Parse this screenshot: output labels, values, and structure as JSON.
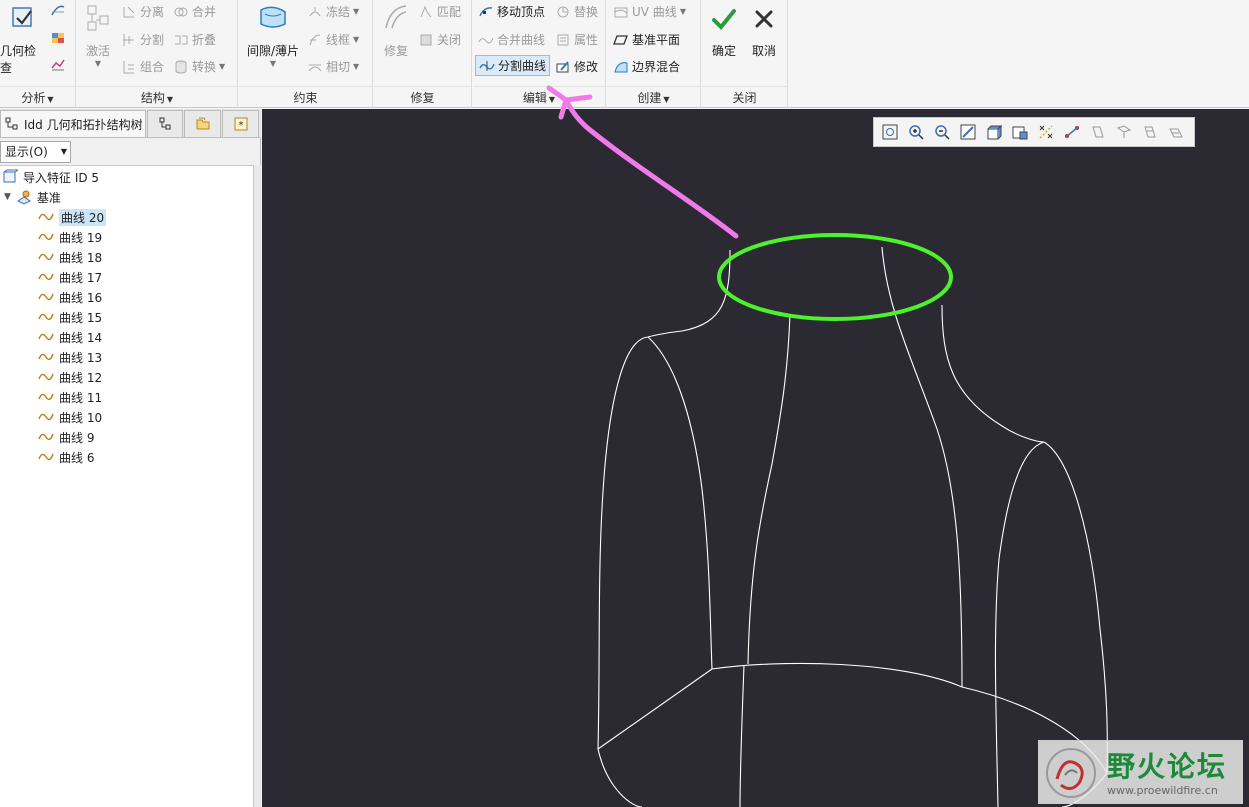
{
  "ribbon": {
    "analysis": {
      "geometry_check": "几何检查",
      "group_label": "分析"
    },
    "structure": {
      "activate": "激活",
      "separate": "分离",
      "merge": "合并",
      "split": "分割",
      "fold": "折叠",
      "combine": "组合",
      "convert": "转换",
      "group_label": "结构"
    },
    "constraint": {
      "gap_thin": "间隙/薄片",
      "freeze": "冻结",
      "wireframe": "线框",
      "tangent": "相切",
      "group_label": "约束"
    },
    "repair": {
      "repair": "修复",
      "match": "匹配",
      "close": "关闭",
      "group_label": "修复"
    },
    "edit": {
      "move_vertex": "移动顶点",
      "replace": "替换",
      "merge_curve": "合并曲线",
      "property": "属性",
      "split_curve": "分割曲线",
      "modify": "修改",
      "group_label": "编辑"
    },
    "create": {
      "uv_curve": "UV 曲线",
      "datum_plane": "基准平面",
      "boundary_blend": "边界混合",
      "group_label": "创建"
    },
    "close_group": {
      "ok": "确定",
      "cancel": "取消",
      "group_label": "关闭"
    }
  },
  "left_panel": {
    "tab_title": "Idd 几何和拓扑结构树",
    "display_label": "显示(O)",
    "tree": {
      "root": "导入特征 ID 5",
      "datum": "基准",
      "curves": [
        "曲线 20",
        "曲线 19",
        "曲线 18",
        "曲线 17",
        "曲线 16",
        "曲线 15",
        "曲线 14",
        "曲线 13",
        "曲线 12",
        "曲线 11",
        "曲线 10",
        "曲线 9",
        "曲线 6"
      ],
      "selected_index": 0
    }
  },
  "watermark": {
    "title": "野火论坛",
    "url": "www.proewildfire.cn"
  },
  "colors": {
    "graphics_bg": "#2b2a33",
    "annotation_ellipse": "#4cf22c",
    "annotation_arrow": "#f07ae8",
    "active_button": "#dbeaf8"
  }
}
